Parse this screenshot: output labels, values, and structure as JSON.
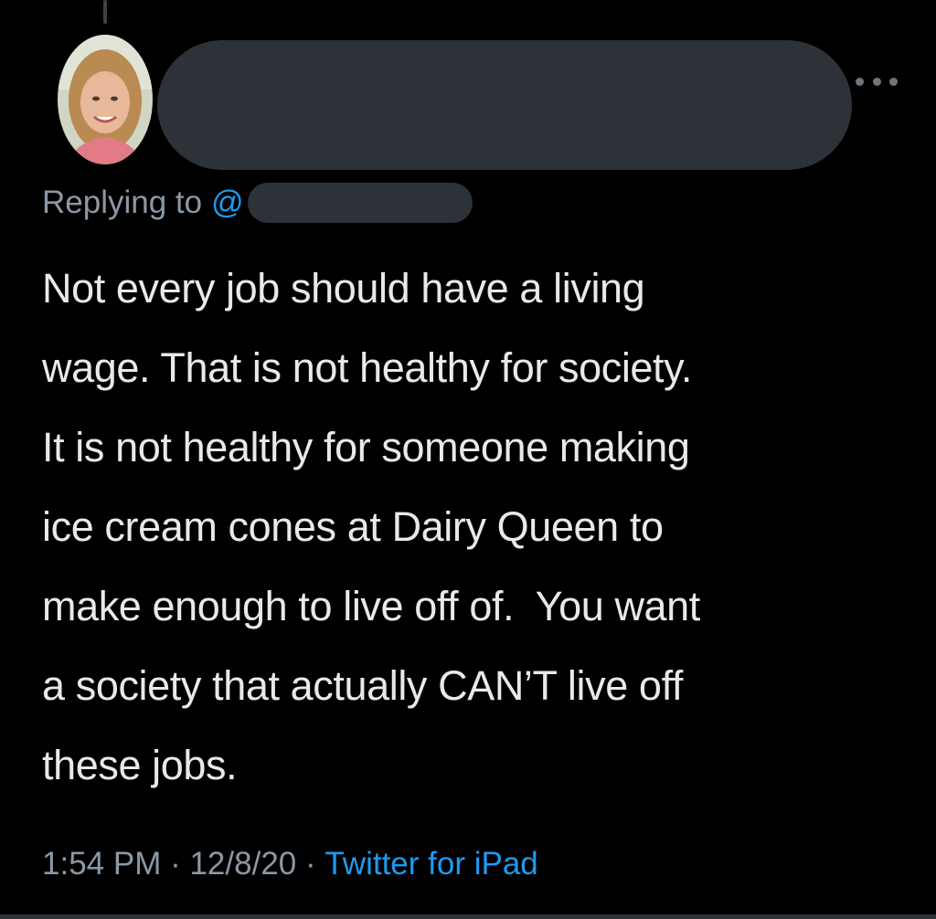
{
  "reply": {
    "prefix": "Replying to",
    "handle_at": "@"
  },
  "tweet": {
    "lines": [
      "Not every job should have a living",
      "wage. That is not healthy for society.",
      "It is not healthy for someone making",
      "ice cream cones at Dairy Queen to",
      "make enough to live off of.  You want",
      "a society that actually CAN’T live off",
      "these jobs."
    ]
  },
  "meta": {
    "time": "1:54 PM",
    "sep1": " · ",
    "date": "12/8/20",
    "sep2": " · ",
    "source": "Twitter for iPad"
  },
  "icons": {
    "more": "more-horizontal-icon",
    "avatar": "profile-photo"
  },
  "colors": {
    "background": "#000000",
    "text": "#e7e9ea",
    "secondary": "#8b98a5",
    "accent": "#1d9bf0",
    "redaction": "#2c3238"
  }
}
